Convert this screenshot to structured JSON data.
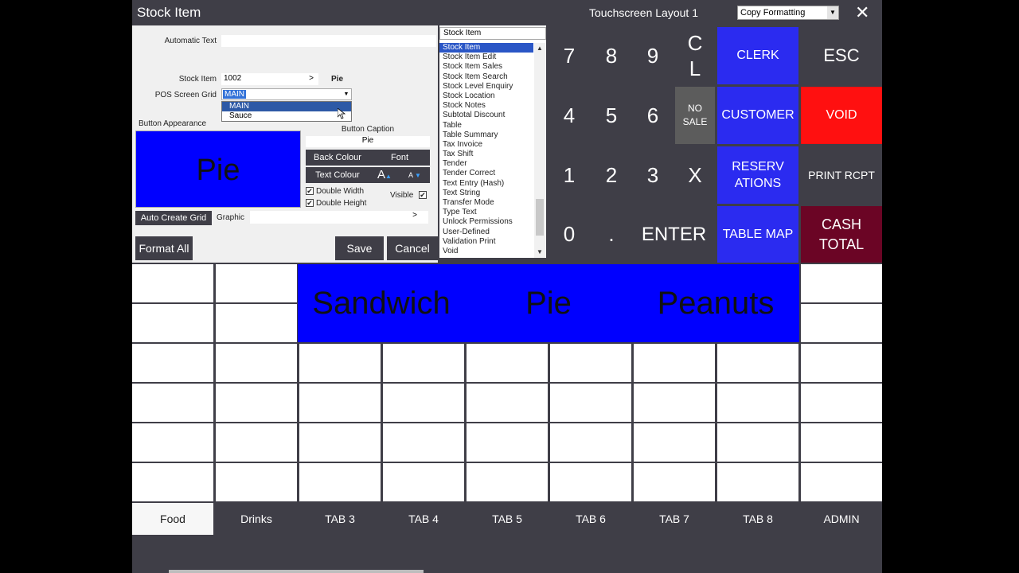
{
  "window": {
    "title": "Stock Item",
    "layout_name": "Touchscreen Layout 1",
    "copy_formatting": "Copy Formatting",
    "close_glyph": "✕"
  },
  "form": {
    "automatic_text_label": "Automatic Text",
    "automatic_text_value": "",
    "stock_item_label": "Stock Item",
    "stock_item_code": "1002",
    "stock_item_arrow": ">",
    "stock_item_name": "Pie",
    "pos_grid_label": "POS Screen Grid",
    "pos_grid_value": "MAIN",
    "pos_grid_options": [
      "MAIN",
      "Sauce"
    ],
    "button_appearance_label": "Button Appearance",
    "preview_text": "Pie",
    "preview_color": "#0000ff",
    "button_caption_label": "Button Caption",
    "button_caption_value": "Pie",
    "back_colour": "Back Colour",
    "font": "Font",
    "text_colour": "Text Colour",
    "font_grow": "A",
    "font_shrink": "A",
    "double_width": "Double Width",
    "double_height": "Double Height",
    "visible": "Visible",
    "auto_create_grid": "Auto Create Grid",
    "graphic_label": "Graphic",
    "graphic_arrow": ">",
    "format_all": "Format All",
    "save": "Save",
    "cancel": "Cancel"
  },
  "function_list": {
    "selected": "Stock Item",
    "items": [
      "Stock Item",
      "Stock Item Edit",
      "Stock Item Sales",
      "Stock Item Search",
      "Stock Level Enquiry",
      "Stock Location",
      "Stock Notes",
      "Subtotal Discount",
      "Table",
      "Table Summary",
      "Tax Invoice",
      "Tax Shift",
      "Tender",
      "Tender Correct",
      "Text Entry (Hash)",
      "Text String",
      "Transfer Mode",
      "Type Text",
      "Unlock Permissions",
      "User-Defined",
      "Validation Print",
      "Void"
    ]
  },
  "keypad": {
    "k7": "7",
    "k8": "8",
    "k9": "9",
    "cl": "C\nL",
    "k4": "4",
    "k5": "5",
    "k6": "6",
    "nosale": "NO\nSALE",
    "k1": "1",
    "k2": "2",
    "k3": "3",
    "x": "X",
    "k0": "0",
    "dot": ".",
    "enter": "ENTER",
    "clerk": "CLERK",
    "esc": "ESC",
    "customer": "CUSTOMER",
    "void": "VOID",
    "reservations": "RESERV\nATIONS",
    "print_rcpt": "PRINT RCPT",
    "table_map": "TABLE MAP",
    "cash_total": "CASH\nTOTAL"
  },
  "grid_buttons": {
    "sandwich": "Sandwich",
    "pie": "Pie",
    "peanuts": "Peanuts"
  },
  "tabs": [
    "Food",
    "Drinks",
    "TAB 3",
    "TAB 4",
    "TAB 5",
    "TAB 6",
    "TAB 7",
    "TAB 8",
    "ADMIN"
  ],
  "colors": {
    "accent_blue": "#2b2bf0",
    "void_red": "#ff1010",
    "cash_total": "#6b0525",
    "panel_dark": "#3f3e47"
  }
}
